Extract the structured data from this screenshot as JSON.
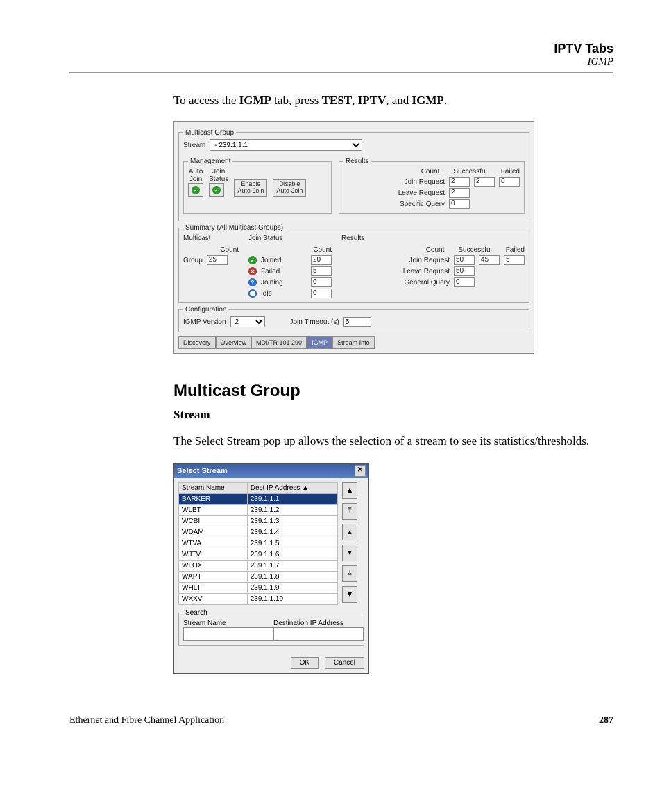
{
  "header": {
    "title": "IPTV Tabs",
    "subtitle": "IGMP"
  },
  "intro": {
    "pre": "To access the ",
    "b1": "IGMP",
    "mid1": " tab, press ",
    "b2": "TEST",
    "sep1": ", ",
    "b3": "IPTV",
    "sep2": ", and ",
    "b4": "IGMP",
    "end": "."
  },
  "panel": {
    "mg_legend": "Multicast Group",
    "stream_label": "Stream",
    "stream_value": "- 239.1.1.1",
    "mgmt": {
      "legend": "Management",
      "auto_join": "Auto\nJoin",
      "join_status": "Join\nStatus",
      "enable": "Enable\nAuto-Join",
      "disable": "Disable\nAuto-Join"
    },
    "results1": {
      "legend": "Results",
      "count": "Count",
      "successful": "Successful",
      "failed": "Failed",
      "join_request": "Join Request",
      "leave_request": "Leave Request",
      "specific_query": "Specific Query",
      "jr_count": "2",
      "jr_succ": "2",
      "jr_fail": "0",
      "lr_count": "2",
      "sq_count": "0"
    },
    "summary": {
      "legend": "Summary (All Multicast Groups)",
      "multicast": "Multicast",
      "join_status": "Join Status",
      "results": "Results",
      "count": "Count",
      "group": "Group",
      "group_v": "25",
      "joined": "Joined",
      "joined_v": "20",
      "failed": "Failed",
      "failed_v": "5",
      "joining": "Joining",
      "joining_v": "0",
      "idle": "Idle",
      "idle_v": "0",
      "join_request": "Join Request",
      "jr_v": "50",
      "leave_request": "Leave Request",
      "lr_v": "50",
      "general_query": "General Query",
      "gq_v": "0",
      "successful": "Successful",
      "succ_v": "45",
      "failed_h": "Failed",
      "fail_v": "5"
    },
    "config": {
      "legend": "Configuration",
      "igmp_version": "IGMP Version",
      "igmp_v": "2",
      "join_timeout": "Join Timeout (s)",
      "jt_v": "5"
    },
    "tabs": {
      "discovery": "Discovery",
      "overview": "Overview",
      "mdi": "MDI/TR 101 290",
      "igmp": "IGMP",
      "stream_info": "Stream Info"
    }
  },
  "section": {
    "title": "Multicast Group",
    "subhead": "Stream"
  },
  "body_text": "The Select Stream pop up allows the selection of a stream to see its statistics/thresholds.",
  "dialog": {
    "title": "Select Stream",
    "col1": "Stream Name",
    "col2": "Dest IP Address",
    "rows": [
      {
        "name": "BARKER",
        "ip": "239.1.1.1",
        "selected": true
      },
      {
        "name": "WLBT",
        "ip": "239.1.1.2"
      },
      {
        "name": "WCBI",
        "ip": "239.1.1.3"
      },
      {
        "name": "WDAM",
        "ip": "239.1.1.4"
      },
      {
        "name": "WTVA",
        "ip": "239.1.1.5"
      },
      {
        "name": "WJTV",
        "ip": "239.1.1.6"
      },
      {
        "name": "WLOX",
        "ip": "239.1.1.7"
      },
      {
        "name": "WAPT",
        "ip": "239.1.1.8"
      },
      {
        "name": "WHLT",
        "ip": "239.1.1.9"
      },
      {
        "name": "WXXV",
        "ip": "239.1.1.10"
      }
    ],
    "search": {
      "legend": "Search",
      "stream_name": "Stream Name",
      "dest_ip": "Destination IP Address"
    },
    "ok": "OK",
    "cancel": "Cancel"
  },
  "footer": {
    "left": "Ethernet and Fibre Channel Application",
    "right": "287"
  }
}
